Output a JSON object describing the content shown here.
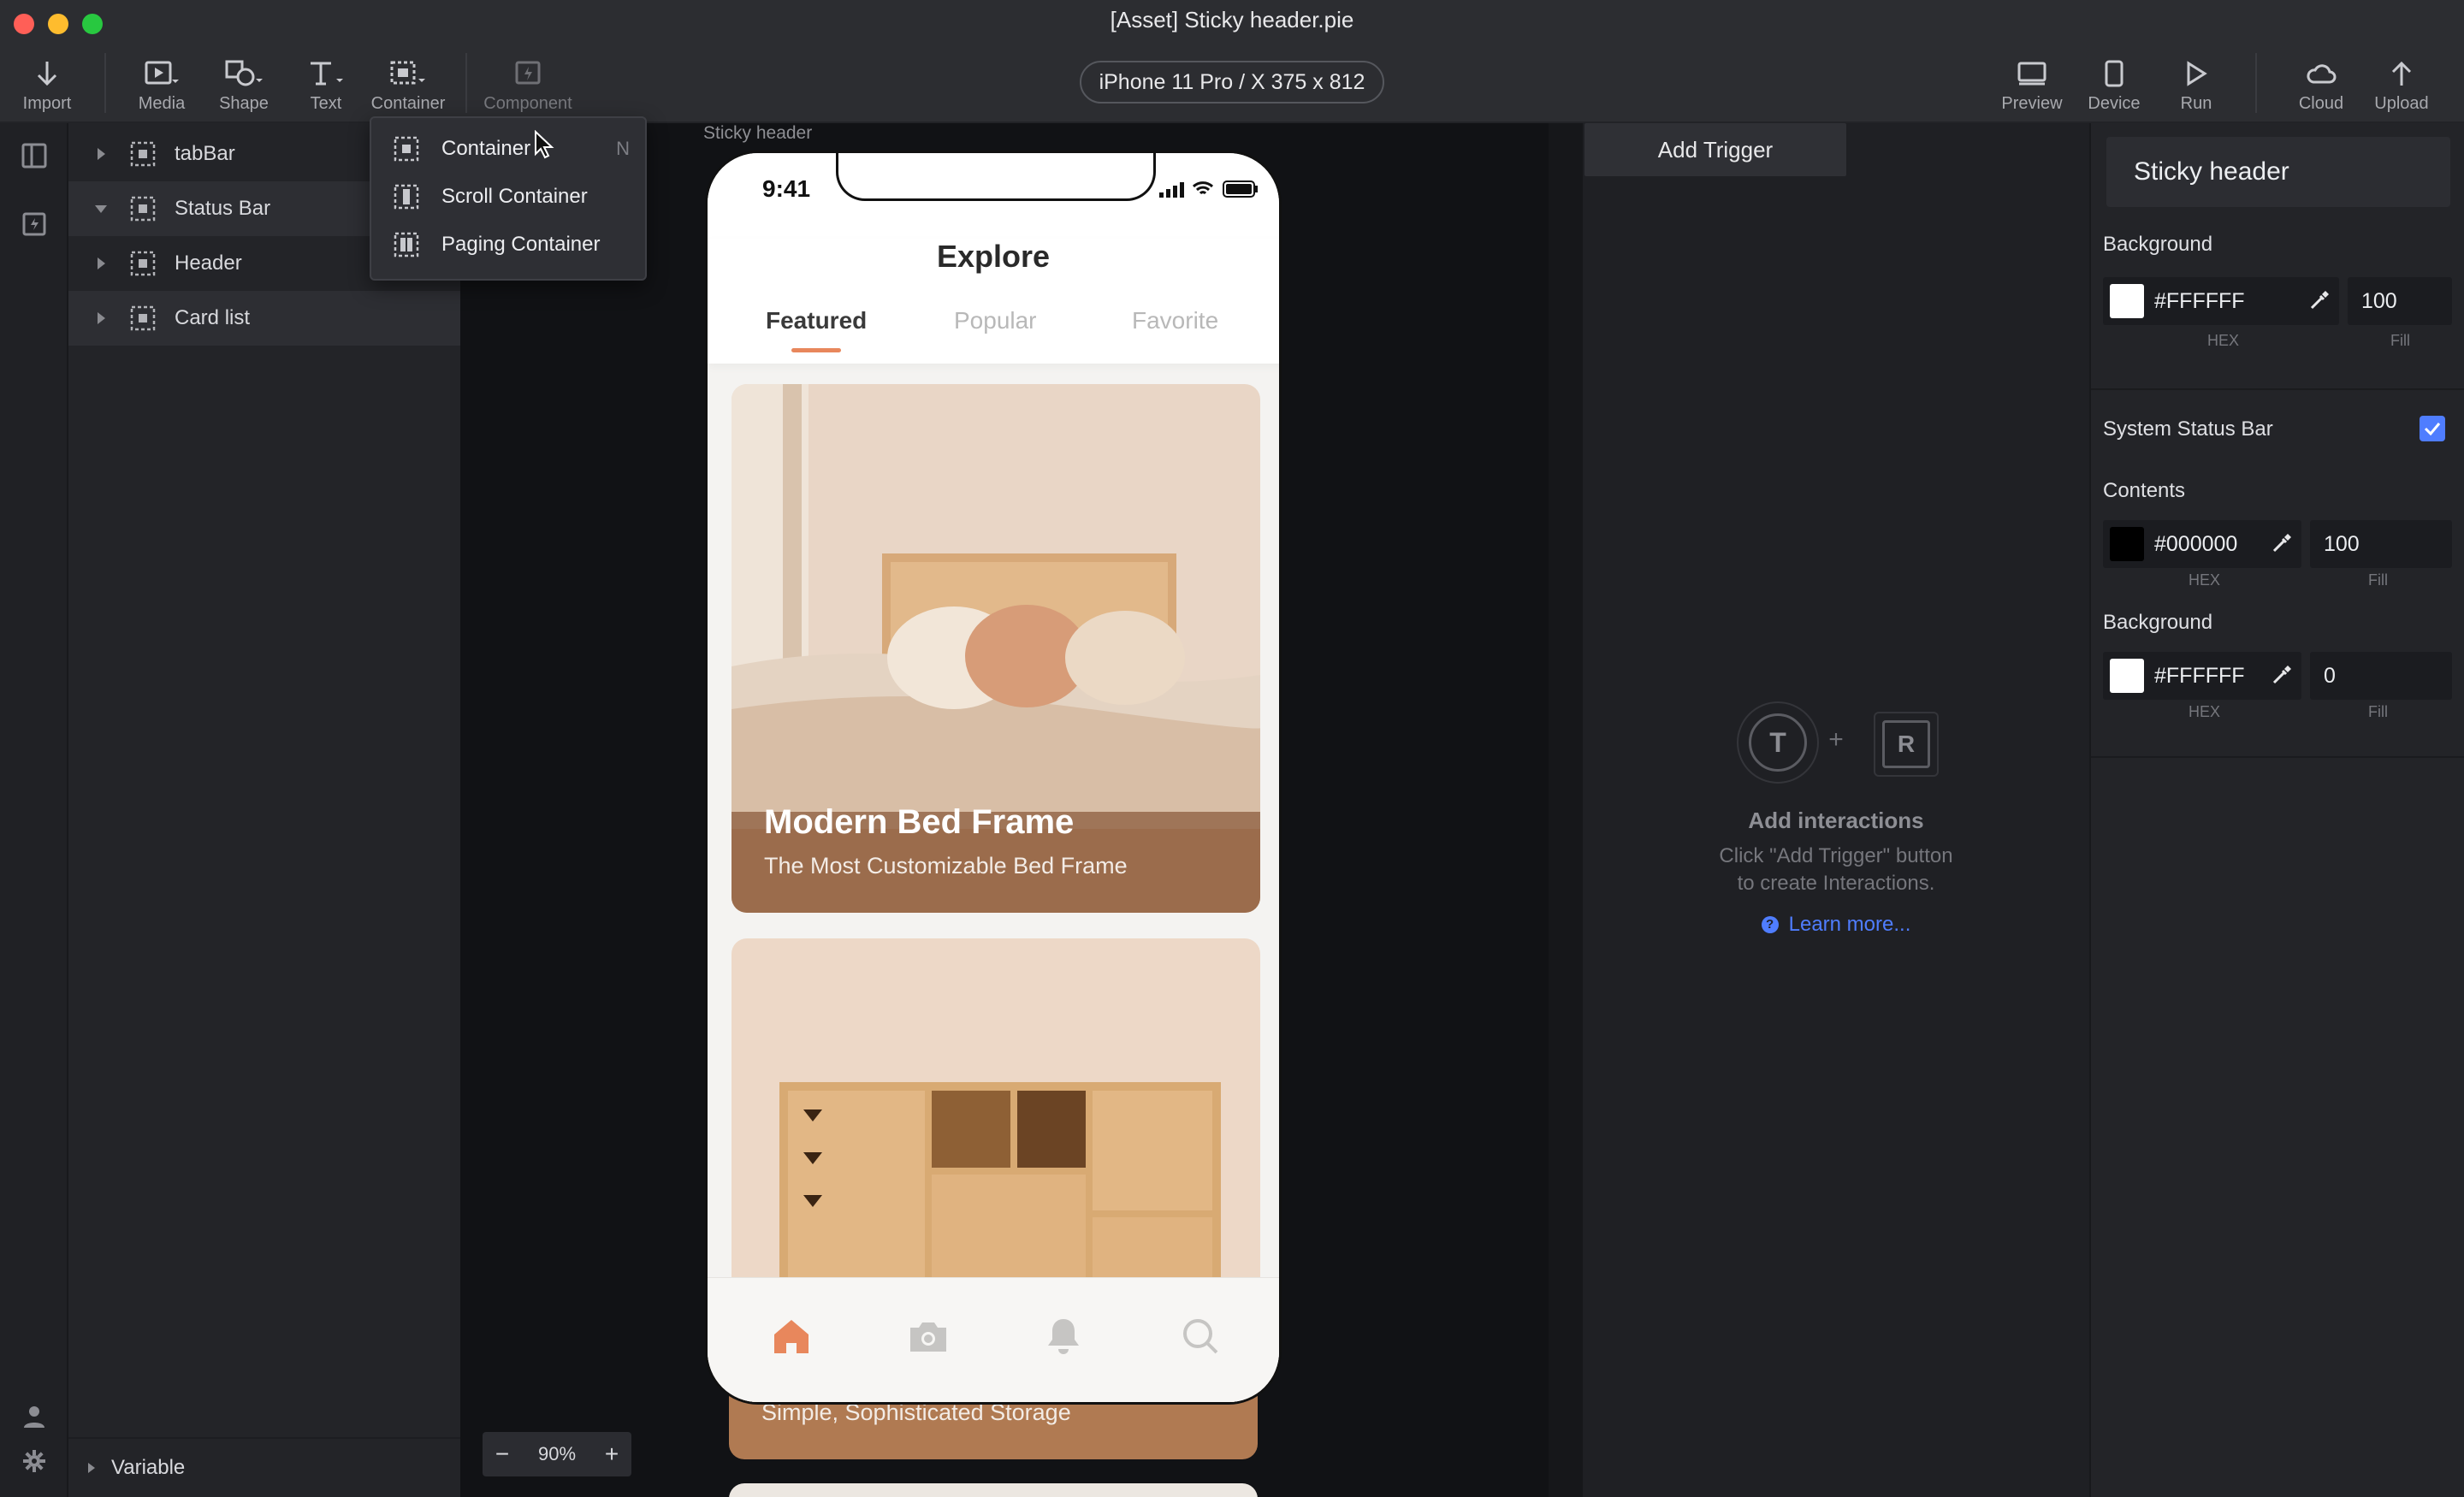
{
  "window": {
    "title": "[Asset] Sticky header.pie"
  },
  "toolbar": {
    "import": "Import",
    "media": "Media",
    "shape": "Shape",
    "text": "Text",
    "container": "Container",
    "component": "Component",
    "device": "iPhone 11 Pro / X  375 x 812",
    "preview": "Preview",
    "device_btn": "Device",
    "run": "Run",
    "cloud": "Cloud",
    "upload": "Upload"
  },
  "layers": {
    "items": [
      {
        "label": "tabBar"
      },
      {
        "label": "Status Bar"
      },
      {
        "label": "Header"
      },
      {
        "label": "Card list"
      }
    ],
    "variable": "Variable"
  },
  "menu": {
    "items": [
      {
        "label": "Container",
        "shortcut": "N"
      },
      {
        "label": "Scroll Container"
      },
      {
        "label": "Paging Container"
      }
    ]
  },
  "canvas": {
    "frame_label": "Sticky header",
    "zoom_minus": "−",
    "zoom_value": "90%",
    "zoom_plus": "+"
  },
  "phone": {
    "time": "9:41",
    "title": "Explore",
    "tabs": [
      "Featured",
      "Popular",
      "Favorite"
    ],
    "active_tab": 0,
    "cards": [
      {
        "title": "Modern Bed Frame",
        "subtitle": "The Most Customizable Bed Frame"
      },
      {
        "title": "",
        "subtitle": "Simple, Sophisticated Storage"
      }
    ],
    "accent": "#E8875C"
  },
  "interactions": {
    "add_trigger": "Add Trigger",
    "badge_t": "T",
    "badge_plus": "+",
    "badge_r": "R",
    "empty_title": "Add interactions",
    "empty_line1": "Click \"Add Trigger\" button",
    "empty_line2": "to create Interactions.",
    "learn_more": "Learn more..."
  },
  "properties": {
    "name": "Sticky header",
    "background_label": "Background",
    "background_hex": "#FFFFFF",
    "background_fill": "100",
    "hex_label": "HEX",
    "fill_label": "Fill",
    "system_status_bar": "System Status Bar",
    "system_status_bar_checked": true,
    "contents_label": "Contents",
    "contents_hex": "#000000",
    "contents_fill": "100",
    "status_bg_label": "Background",
    "status_bg_hex": "#FFFFFF",
    "status_bg_fill": "0"
  }
}
